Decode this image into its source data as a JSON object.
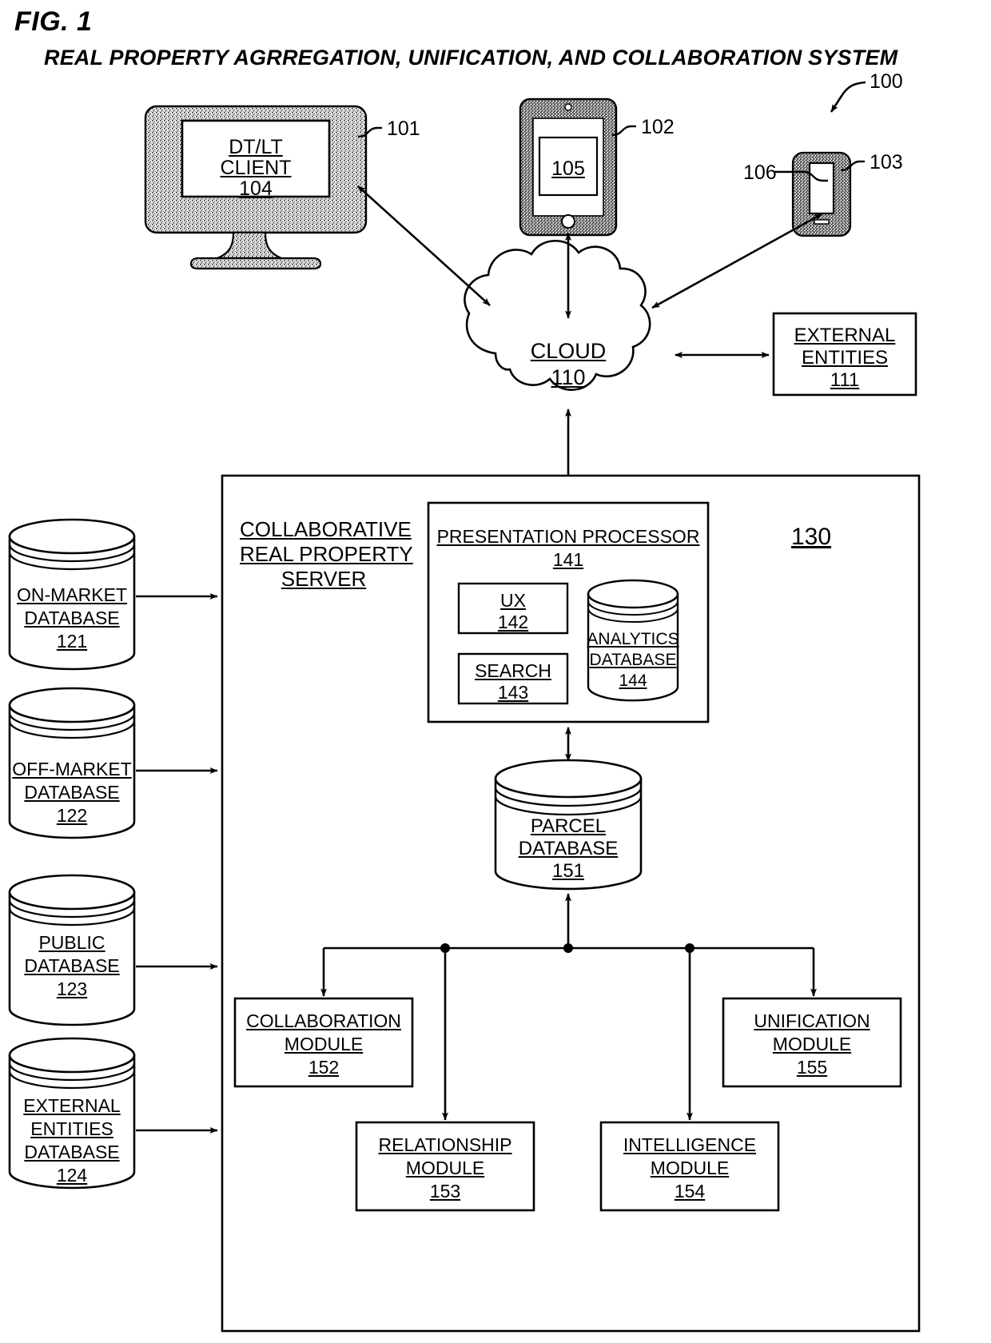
{
  "figure": {
    "number": "FIG. 1",
    "title": "REAL PROPERTY AGRREGATION, UNIFICATION, AND COLLABORATION SYSTEM",
    "system_ref": "100"
  },
  "clients": {
    "desktop": {
      "ref": "101",
      "screen_line1": "DT/LT",
      "screen_line2": "CLIENT",
      "screen_ref": "104"
    },
    "tablet": {
      "ref": "102",
      "screen_ref": "105"
    },
    "phone": {
      "ref": "103",
      "screen_ref": "106"
    }
  },
  "cloud": {
    "label": "CLOUD",
    "ref": "110"
  },
  "external_entities": {
    "line1": "EXTERNAL",
    "line2": "ENTITIES",
    "ref": "111"
  },
  "server": {
    "ref": "130",
    "title_line1": "COLLABORATIVE",
    "title_line2": "REAL PROPERTY",
    "title_line3": "SERVER",
    "presentation_processor": {
      "label": "PRESENTATION PROCESSOR",
      "ref": "141",
      "ux": {
        "label": "UX",
        "ref": "142"
      },
      "search": {
        "label": "SEARCH",
        "ref": "143"
      },
      "analytics_db": {
        "line1": "ANALYTICS",
        "line2": "DATABASE",
        "ref": "144"
      }
    },
    "parcel_db": {
      "line1": "PARCEL",
      "line2": "DATABASE",
      "ref": "151"
    },
    "modules": [
      {
        "line1": "COLLABORATION",
        "line2": "MODULE",
        "ref": "152"
      },
      {
        "line1": "RELATIONSHIP",
        "line2": "MODULE",
        "ref": "153"
      },
      {
        "line1": "INTELLIGENCE",
        "line2": "MODULE",
        "ref": "154"
      },
      {
        "line1": "UNIFICATION",
        "line2": "MODULE",
        "ref": "155"
      }
    ]
  },
  "source_databases": [
    {
      "line1": "ON-MARKET",
      "line2": "DATABASE",
      "line3": "",
      "ref": "121"
    },
    {
      "line1": "OFF-MARKET",
      "line2": "DATABASE",
      "line3": "",
      "ref": "122"
    },
    {
      "line1": "PUBLIC",
      "line2": "DATABASE",
      "line3": "",
      "ref": "123"
    },
    {
      "line1": "EXTERNAL",
      "line2": "ENTITIES",
      "line3": "DATABASE",
      "ref": "124"
    }
  ]
}
